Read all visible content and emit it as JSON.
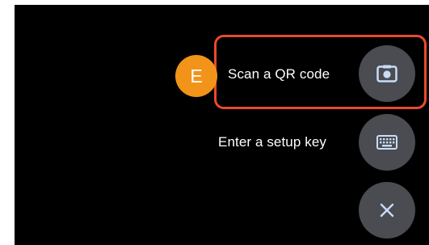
{
  "menu": {
    "scan_qr_label": "Scan a QR code",
    "setup_key_label": "Enter a setup key"
  },
  "annotation": {
    "marker_letter": "E",
    "highlight_color": "#ea4a2b",
    "marker_color": "#f19419"
  },
  "icons": {
    "scan_qr": "camera-icon",
    "setup_key": "keyboard-icon",
    "close": "close-icon"
  },
  "colors": {
    "background": "#000000",
    "fab": "#4a4c52",
    "icon": "#c9dcf7",
    "text": "#ffffff"
  }
}
